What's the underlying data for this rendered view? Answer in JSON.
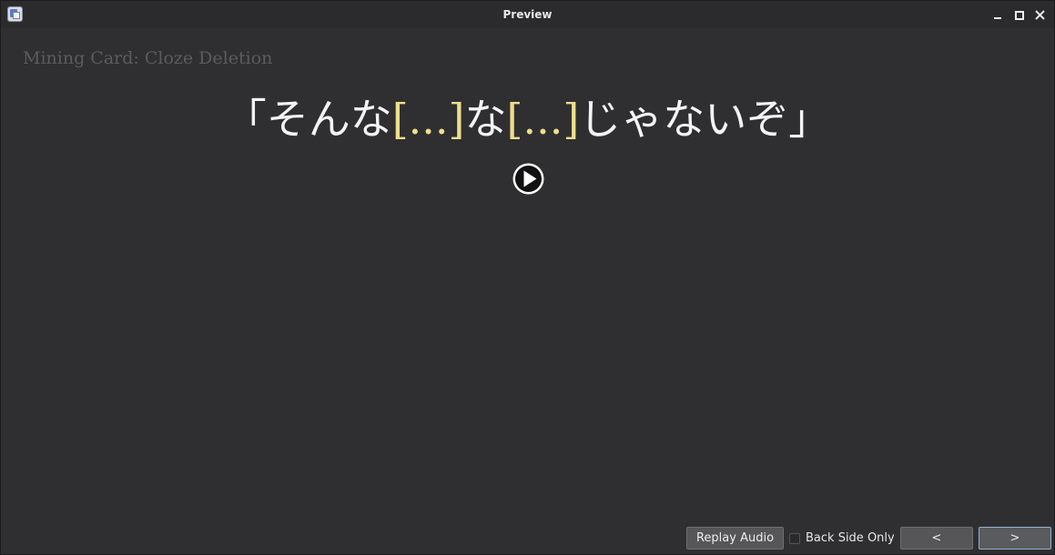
{
  "window": {
    "title": "Preview"
  },
  "card": {
    "note_type": "Mining Card: Cloze Deletion",
    "sentence_parts": {
      "open": "「そんな",
      "cloze1": "[...]",
      "middle": "な",
      "cloze2": "[...]",
      "close": "じゃないぞ」"
    }
  },
  "controls": {
    "replay_label": "Replay Audio",
    "back_side_only_label": "Back Side Only",
    "back_side_only_checked": false,
    "prev_label": "<",
    "next_label": ">"
  },
  "colors": {
    "background": "#2f2f31",
    "text": "#f4f4f4",
    "cloze": "#eedf8c",
    "muted": "#5c5c5e",
    "accent_border": "#8fb4d6"
  },
  "icons": {
    "app": "anki-app-icon",
    "play": "play-icon",
    "minimize": "minimize-icon",
    "maximize": "maximize-icon",
    "close": "close-icon"
  }
}
